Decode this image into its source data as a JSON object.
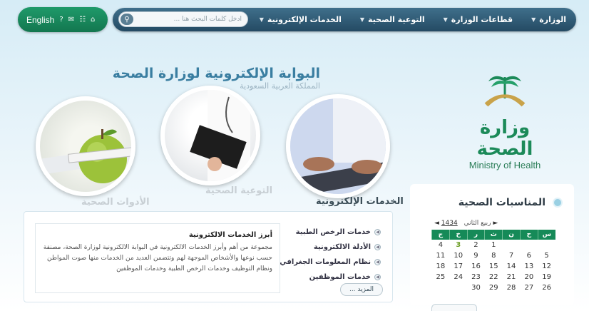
{
  "nav": {
    "items": [
      {
        "label": "الوزارة"
      },
      {
        "label": "قطاعات الوزارة"
      },
      {
        "label": "التوعية الصحية"
      },
      {
        "label": "الخدمات الإلكترونية"
      }
    ],
    "search_placeholder": "أدخل كلمات البحث هنا ..."
  },
  "language": {
    "label": "English"
  },
  "logo": {
    "arabic": "وزارة الصحة",
    "english": "Ministry of Health"
  },
  "portal": {
    "title": "البوابة الإلكترونية لوزارة الصحة",
    "subtitle": "المملكة العربية السعودية"
  },
  "sections": {
    "tools": "الأدوات الصحية",
    "awareness": "التوعية الصحية",
    "eservices": "الخدمات الإلكترونية"
  },
  "eservices_list": [
    "خدمات الرخص الطبية",
    "الأدلة الالكترونية",
    "نظام المعلومات الجغرافي",
    "خدمات الموظفين"
  ],
  "description": {
    "title": "أبرز الخدمات الالكترونية",
    "text": "مجموعة من أهم وأبرز الخدمات الالكترونية في البوابة الالكترونية لوزارة الصحة، مصنفة حسب نوعها والأشخاص الموجهة لهم وتتضمن العديد من الخدمات منها صوت المواطن ونظام التوظيف وخدمات الرخص الطبية وخدمات الموظفين"
  },
  "more_button": "المزيد ...",
  "events": {
    "title": "المناسبات الصحية",
    "month": "ربيع الثاني",
    "year": "1434",
    "weekdays": [
      "س",
      "ح",
      "ن",
      "ث",
      "ر",
      "خ",
      "ج"
    ],
    "weeks": [
      [
        "",
        "",
        "",
        "1",
        "2",
        "3",
        "4"
      ],
      [
        "5",
        "6",
        "7",
        "8",
        "9",
        "10",
        "11"
      ],
      [
        "12",
        "13",
        "14",
        "15",
        "16",
        "17",
        "18"
      ],
      [
        "19",
        "20",
        "21",
        "22",
        "23",
        "24",
        "25"
      ],
      [
        "26",
        "27",
        "28",
        "29",
        "30",
        "",
        ""
      ]
    ],
    "today": "3"
  },
  "colors": {
    "nav_bg": "#2f5a75",
    "green": "#168a58",
    "title_blue": "#3a7ea1"
  }
}
